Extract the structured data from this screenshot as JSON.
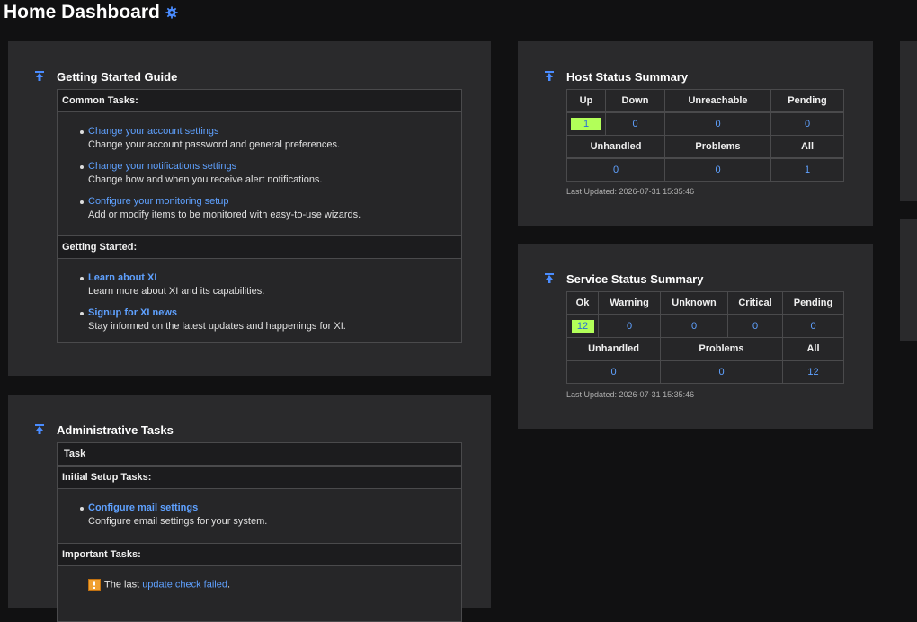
{
  "page": {
    "title": "Home Dashboard"
  },
  "getting_started": {
    "title": "Getting Started Guide",
    "common_tasks_header": "Common Tasks:",
    "common_tasks": [
      {
        "link": "Change your account settings",
        "desc": "Change your account password and general preferences."
      },
      {
        "link": "Change your notifications settings",
        "desc": "Change how and when you receive alert notifications."
      },
      {
        "link": "Configure your monitoring setup",
        "desc": "Add or modify items to be monitored with easy-to-use wizards."
      }
    ],
    "getting_started_header": "Getting Started:",
    "getting_started_items": [
      {
        "link": "Learn about XI",
        "desc": "Learn more about XI and its capabilities."
      },
      {
        "link": "Signup for XI news",
        "desc": "Stay informed on the latest updates and happenings for XI."
      }
    ]
  },
  "admin_tasks": {
    "title": "Administrative Tasks",
    "task_header": "Task",
    "initial_header": "Initial Setup Tasks:",
    "initial_items": [
      {
        "link": "Configure mail settings",
        "desc": "Configure email settings for your system."
      }
    ],
    "important_header": "Important Tasks:",
    "important_prefix": "The last ",
    "important_link": "update check failed",
    "important_suffix": "."
  },
  "host_status": {
    "title": "Host Status Summary",
    "headers": [
      "Up",
      "Down",
      "Unreachable",
      "Pending"
    ],
    "values": [
      "1",
      "0",
      "0",
      "0"
    ],
    "headers2": [
      "Unhandled",
      "Problems",
      "All"
    ],
    "values2": [
      "0",
      "0",
      "1"
    ],
    "updated": "Last Updated: 2026-07-31 15:35:46",
    "ok_color": "#b2ff59"
  },
  "service_status": {
    "title": "Service Status Summary",
    "headers": [
      "Ok",
      "Warning",
      "Unknown",
      "Critical",
      "Pending"
    ],
    "values": [
      "12",
      "0",
      "0",
      "0",
      "0"
    ],
    "headers2": [
      "Unhandled",
      "Problems",
      "All"
    ],
    "values2": [
      "0",
      "0",
      "12"
    ],
    "updated": "Last Updated: 2026-07-31 15:35:46"
  },
  "icons": {
    "settings": "gear-icon",
    "pin": "pin-icon",
    "warning": "warning-icon"
  }
}
